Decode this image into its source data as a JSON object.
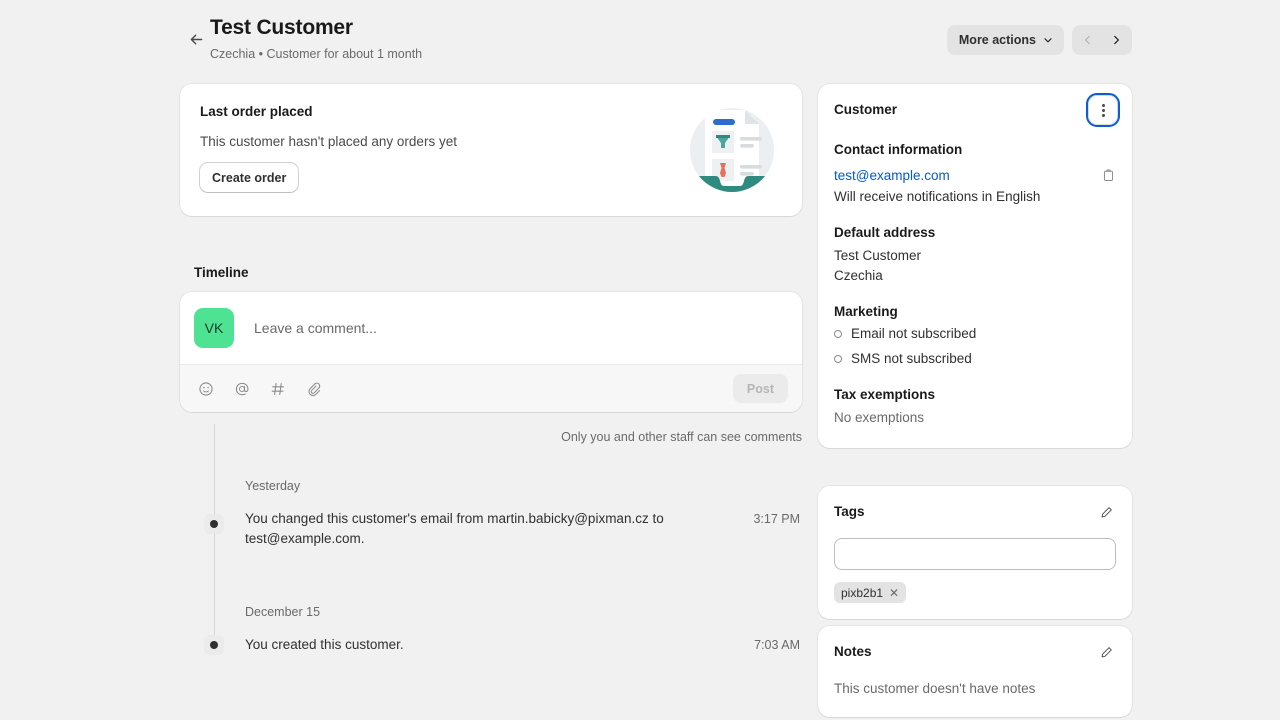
{
  "header": {
    "back_icon": "arrow-left-icon",
    "title": "Test Customer",
    "subtitle": "Czechia • Customer for about 1 month",
    "more_actions_label": "More actions",
    "chevron_icon": "chevron-down-icon",
    "prev_icon": "chevron-left-icon",
    "next_icon": "chevron-right-icon"
  },
  "last_order": {
    "title": "Last order placed",
    "description": "This customer hasn't placed any orders yet",
    "button_label": "Create order",
    "illustration": "order-document-illustration",
    "illustration_colors": {
      "teal": "#2f8a80",
      "blue": "#2c6ecb",
      "red": "#e8705a",
      "paper": "#ffffff",
      "circle": "#eceff1"
    }
  },
  "timeline": {
    "heading": "Timeline",
    "composer": {
      "avatar_initials": "VK",
      "avatar_color": "#4ee392",
      "placeholder": "Leave a comment...",
      "value": "",
      "tools": [
        "emoji-icon",
        "mention-icon",
        "hashtag-icon",
        "attachment-icon"
      ],
      "post_label": "Post"
    },
    "privacy_note": "Only you and other staff can see comments",
    "groups": [
      {
        "date": "Yesterday",
        "events": [
          {
            "text": "You changed this customer's email from martin.babicky@pixman.cz to test@example.com.",
            "time": "3:17 PM"
          }
        ]
      },
      {
        "date": "December 15",
        "events": [
          {
            "text": "You created this customer.",
            "time": "7:03 AM"
          }
        ]
      }
    ]
  },
  "customer_card": {
    "title": "Customer",
    "menu_icon": "kebab-menu-icon",
    "contact_heading": "Contact information",
    "email": "test@example.com",
    "copy_icon": "clipboard-copy-icon",
    "notifications_note": "Will receive notifications in English",
    "address_heading": "Default address",
    "address_name": "Test Customer",
    "address_country": "Czechia",
    "marketing_heading": "Marketing",
    "marketing_items": [
      "Email not subscribed",
      "SMS not subscribed"
    ],
    "tax_heading": "Tax exemptions",
    "tax_value": "No exemptions",
    "link_color": "#005bd3",
    "focus_ring_color": "#0b5cd5"
  },
  "tags_card": {
    "title": "Tags",
    "edit_icon": "pencil-edit-icon",
    "input_value": "",
    "input_placeholder": "",
    "tags": [
      "pixb2b1"
    ],
    "remove_icon": "close-x-icon"
  },
  "notes_card": {
    "title": "Notes",
    "edit_icon": "pencil-edit-icon",
    "empty_text": "This customer doesn't have notes"
  }
}
